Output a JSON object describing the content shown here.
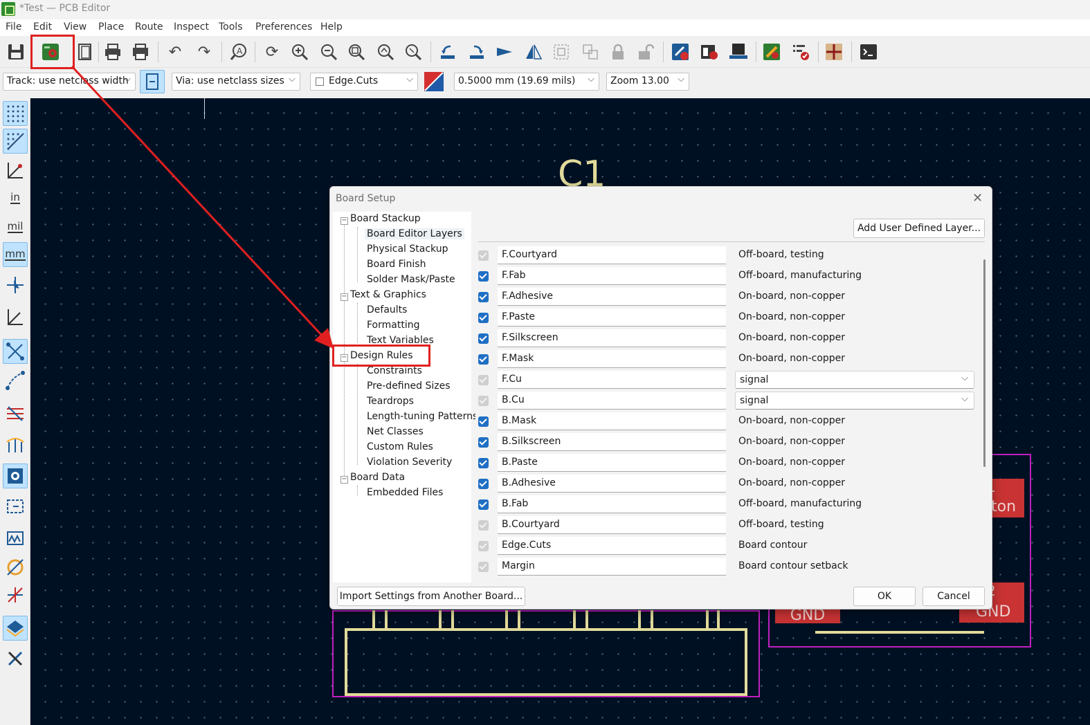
{
  "window": {
    "title": "*Test — PCB Editor"
  },
  "menu": [
    "File",
    "Edit",
    "View",
    "Place",
    "Route",
    "Inspect",
    "Tools",
    "Preferences",
    "Help"
  ],
  "toolbar": {
    "icons": [
      "save-icon",
      "board-setup-icon",
      "page-settings-icon",
      "print-icon",
      "plot-icon",
      "undo-icon",
      "redo-icon",
      "find-icon",
      "refresh-icon",
      "zoom-in-icon",
      "zoom-out-icon",
      "zoom-fit-icon",
      "zoom-objects-icon",
      "zoom-selection-icon",
      "rotate-ccw-icon",
      "rotate-cw-icon",
      "flip-icon",
      "mirror-icon",
      "group-icon",
      "ungroup-icon",
      "lock-icon",
      "unlock-icon",
      "update-pcb-icon",
      "footprint-editor-icon",
      "footprint-browser-icon",
      "drc-icon",
      "design-rules-check-icon",
      "route-icon",
      "scripting-console-icon"
    ]
  },
  "combos": {
    "track": "Track: use netclass width",
    "via": "Via: use netclass sizes",
    "layer": "Edge.Cuts",
    "grid": "0.5000 mm (19.69 mils)",
    "zoom": "Zoom 13.00"
  },
  "left_toolbar": {
    "unit_in": "in",
    "unit_mil": "mil",
    "unit_mm": "mm"
  },
  "canvas": {
    "ref_c1": "C1",
    "pad_gnd_left": "GND",
    "pad_gnd_right": "GND",
    "pad_fragment_top": "ton",
    "pad_digit_top": "1",
    "pad_digit_bottom": "2"
  },
  "dialog": {
    "title": "Board Setup",
    "tree": [
      {
        "label": "Board Stackup",
        "level": 0
      },
      {
        "label": "Board Editor Layers",
        "level": 1,
        "selected": true
      },
      {
        "label": "Physical Stackup",
        "level": 1
      },
      {
        "label": "Board Finish",
        "level": 1
      },
      {
        "label": "Solder Mask/Paste",
        "level": 1
      },
      {
        "label": "Text & Graphics",
        "level": 0
      },
      {
        "label": "Defaults",
        "level": 1
      },
      {
        "label": "Formatting",
        "level": 1
      },
      {
        "label": "Text Variables",
        "level": 1
      },
      {
        "label": "Design Rules",
        "level": 0,
        "highlighted": true
      },
      {
        "label": "Constraints",
        "level": 1
      },
      {
        "label": "Pre-defined Sizes",
        "level": 1
      },
      {
        "label": "Teardrops",
        "level": 1
      },
      {
        "label": "Length-tuning Patterns",
        "level": 1
      },
      {
        "label": "Net Classes",
        "level": 1
      },
      {
        "label": "Custom Rules",
        "level": 1
      },
      {
        "label": "Violation Severity",
        "level": 1
      },
      {
        "label": "Board Data",
        "level": 0
      },
      {
        "label": "Embedded Files",
        "level": 1
      }
    ],
    "add_layer_label": "Add User Defined Layer...",
    "layers": [
      {
        "name": "F.Courtyard",
        "enabled": false,
        "type": "Off-board, testing",
        "is_select": false
      },
      {
        "name": "F.Fab",
        "enabled": true,
        "type": "Off-board, manufacturing",
        "is_select": false
      },
      {
        "name": "F.Adhesive",
        "enabled": true,
        "type": "On-board, non-copper",
        "is_select": false
      },
      {
        "name": "F.Paste",
        "enabled": true,
        "type": "On-board, non-copper",
        "is_select": false
      },
      {
        "name": "F.Silkscreen",
        "enabled": true,
        "type": "On-board, non-copper",
        "is_select": false
      },
      {
        "name": "F.Mask",
        "enabled": true,
        "type": "On-board, non-copper",
        "is_select": false
      },
      {
        "name": "F.Cu",
        "enabled": false,
        "type": "signal",
        "is_select": true
      },
      {
        "name": "B.Cu",
        "enabled": false,
        "type": "signal",
        "is_select": true
      },
      {
        "name": "B.Mask",
        "enabled": true,
        "type": "On-board, non-copper",
        "is_select": false
      },
      {
        "name": "B.Silkscreen",
        "enabled": true,
        "type": "On-board, non-copper",
        "is_select": false
      },
      {
        "name": "B.Paste",
        "enabled": true,
        "type": "On-board, non-copper",
        "is_select": false
      },
      {
        "name": "B.Adhesive",
        "enabled": true,
        "type": "On-board, non-copper",
        "is_select": false
      },
      {
        "name": "B.Fab",
        "enabled": true,
        "type": "Off-board, manufacturing",
        "is_select": false
      },
      {
        "name": "B.Courtyard",
        "enabled": false,
        "type": "Off-board, testing",
        "is_select": false
      },
      {
        "name": "Edge.Cuts",
        "enabled": false,
        "type": "Board contour",
        "is_select": false
      },
      {
        "name": "Margin",
        "enabled": false,
        "type": "Board contour setback",
        "is_select": false
      }
    ],
    "import_label": "Import Settings from Another Board...",
    "ok_label": "OK",
    "cancel_label": "Cancel"
  },
  "colors": {
    "canvas_bg": "#001023",
    "annotation_red": "#e02020",
    "silkscreen": "#e2db9a",
    "courtyard": "#c020c0",
    "pad_red": "#c93333",
    "checkbox_blue": "#1f6fc4"
  }
}
